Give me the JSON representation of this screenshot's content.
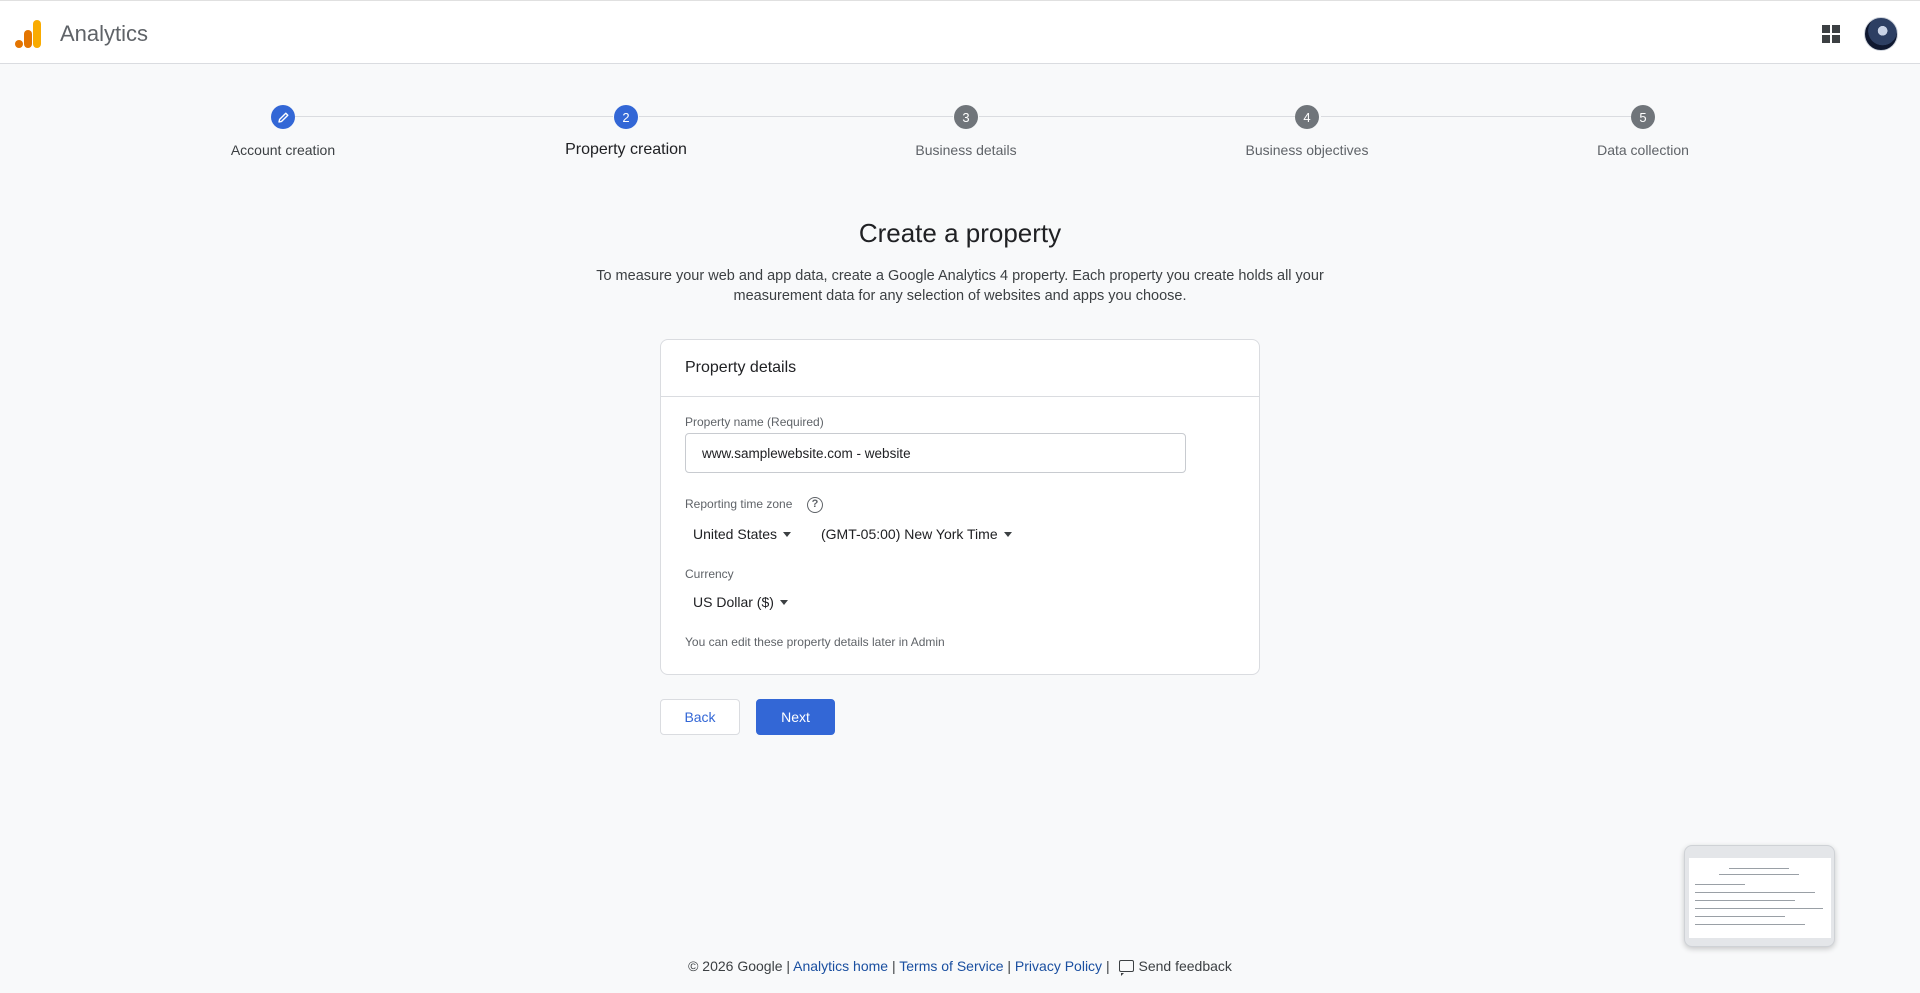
{
  "header": {
    "app_title": "Analytics",
    "logo_icon": "analytics-logo-icon",
    "apps_icon": "apps-grid-icon",
    "brand_colors": [
      "#f9ab00",
      "#e37400"
    ]
  },
  "stepper": {
    "steps": [
      {
        "number": "",
        "label": "Account creation",
        "state": "done",
        "icon": "pencil-icon"
      },
      {
        "number": "2",
        "label": "Property creation",
        "state": "active"
      },
      {
        "number": "3",
        "label": "Business details",
        "state": "pending"
      },
      {
        "number": "4",
        "label": "Business objectives",
        "state": "pending"
      },
      {
        "number": "5",
        "label": "Data collection",
        "state": "pending"
      }
    ],
    "accent_color": "#3367d6"
  },
  "main": {
    "title": "Create a property",
    "description_line1": "To measure your web and app data, create a Google Analytics 4 property. Each property you create holds all your",
    "description_line2": "measurement data for any selection of websites and apps you choose."
  },
  "card": {
    "header": "Property details",
    "property_name_label": "Property name (Required)",
    "property_name_value": "www.samplewebsite.com - website",
    "timezone_label": "Reporting time zone",
    "help_glyph": "?",
    "country_value": "United States",
    "timezone_value": "(GMT-05:00) New York Time",
    "currency_label": "Currency",
    "currency_value": "US Dollar ($)",
    "hint": "You can edit these property details later in Admin"
  },
  "buttons": {
    "back_label": "Back",
    "next_label": "Next"
  },
  "footer": {
    "copyright": "© 2026 Google |",
    "analytics_home": "Analytics home",
    "sep1": "|",
    "terms": "Terms of Service",
    "sep2": "|",
    "privacy": "Privacy Policy",
    "sep3": "|",
    "feedback": "Send feedback"
  }
}
